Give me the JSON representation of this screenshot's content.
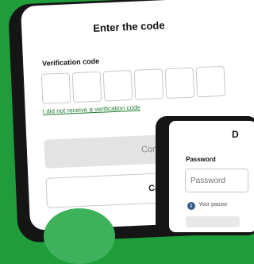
{
  "verify": {
    "title": "Enter the code",
    "code_label": "Verification code",
    "code_boxes": [
      "",
      "",
      "",
      "",
      "",
      ""
    ],
    "resend_link": "I did not receive a verification code",
    "continue_label": "Continue",
    "cancel_label": "Cancel"
  },
  "password_screen": {
    "title_partial": "D",
    "password_label": "Password",
    "password_placeholder": "Password",
    "hint_text": "Your passw"
  },
  "colors": {
    "background": "#1f9d3a",
    "link": "#1f7a2e",
    "disabled_button": "#e3e3e3"
  }
}
